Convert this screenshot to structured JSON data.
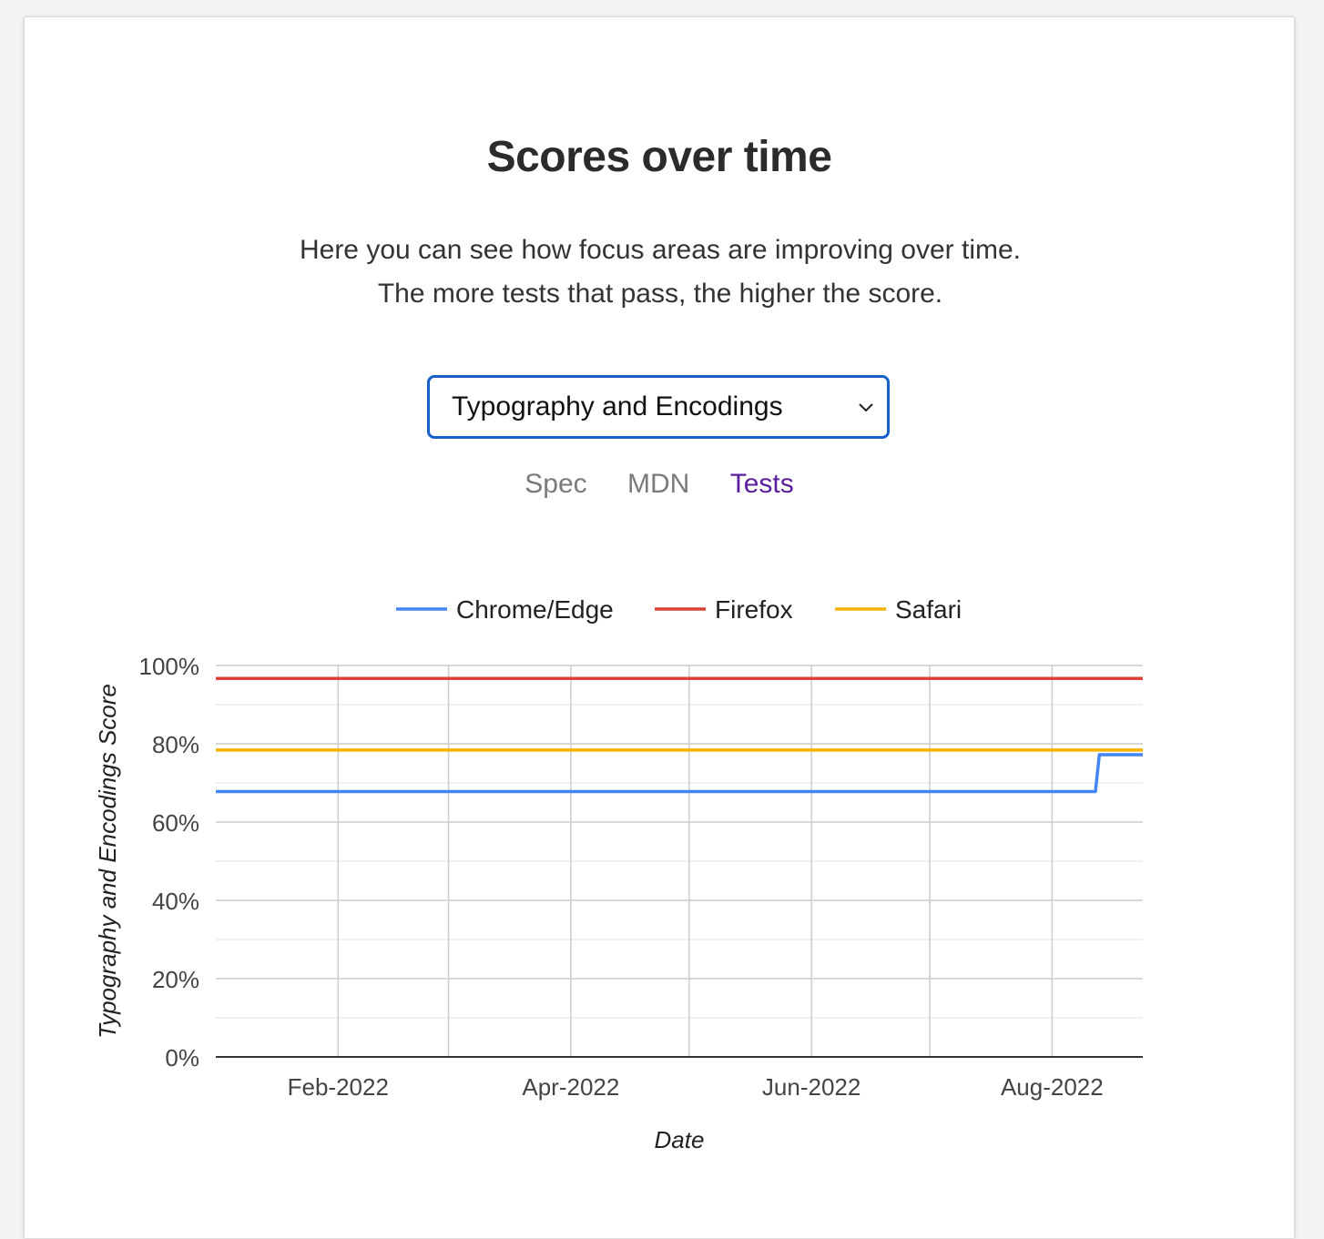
{
  "page": {
    "title": "Scores over time",
    "description": "Here you can see how focus areas are improving over time. The more tests that pass, the higher the score."
  },
  "select": {
    "value": "Typography and Encodings",
    "icon": "chevron-down-icon"
  },
  "links": {
    "spec": "Spec",
    "mdn": "MDN",
    "tests": "Tests"
  },
  "colors": {
    "chrome": "#4285f4",
    "firefox": "#db4437",
    "safari": "#f4b400",
    "select_border": "#1560c9",
    "tests_link": "#5a1e9e"
  },
  "chart_data": {
    "type": "line",
    "xlabel": "Date",
    "ylabel": "Typography and Encodings Score",
    "x_tick_labels": [
      "Feb-2022",
      "Apr-2022",
      "Jun-2022",
      "Aug-2022"
    ],
    "x_ticks": [
      "2022-02-01",
      "2022-04-01",
      "2022-06-01",
      "2022-08-01"
    ],
    "xlim": [
      "2022-01-01",
      "2022-08-24"
    ],
    "y_tick_labels": [
      "0%",
      "20%",
      "40%",
      "60%",
      "80%",
      "100%"
    ],
    "ylim": [
      0,
      100
    ],
    "grid": true,
    "legend": "top",
    "series": [
      {
        "name": "Chrome/Edge",
        "color": "#4285f4",
        "points": [
          {
            "x": "2022-01-01",
            "y": 67.8
          },
          {
            "x": "2022-08-12",
            "y": 67.8
          },
          {
            "x": "2022-08-13",
            "y": 77.2
          },
          {
            "x": "2022-08-24",
            "y": 77.2
          }
        ]
      },
      {
        "name": "Firefox",
        "color": "#db4437",
        "points": [
          {
            "x": "2022-01-01",
            "y": 96.7
          },
          {
            "x": "2022-08-24",
            "y": 96.7
          }
        ]
      },
      {
        "name": "Safari",
        "color": "#f4b400",
        "points": [
          {
            "x": "2022-01-01",
            "y": 78.4
          },
          {
            "x": "2022-08-24",
            "y": 78.4
          }
        ]
      }
    ]
  }
}
